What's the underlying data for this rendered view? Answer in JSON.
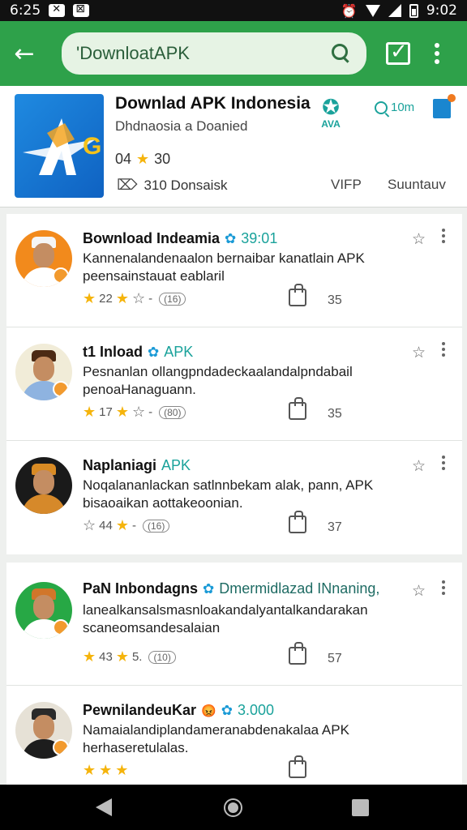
{
  "status_bar": {
    "time_left": "6:25",
    "time_right": "9:02"
  },
  "toolbar": {
    "search_value": "'DownloatAPK"
  },
  "app": {
    "title": "Downlad APK Indonesia",
    "subtitle": "Dhdnaosia a Doanied",
    "rating": "04",
    "reviews": "30",
    "downloads": "310 Donsaisk",
    "vip": "VIFP",
    "subscribe": "Suuntauv",
    "badge": "AVA",
    "quick_search": "10m"
  },
  "comments": [
    {
      "name": "Bownload Indeamia",
      "tag": "39:01",
      "message": "Kannenalandenaalon bernaibar kanatlain APK peensainstauat eablaril",
      "rating_a": "22",
      "rating_b": "(16)",
      "likes": "35",
      "colors": {
        "bg": "#f28a1c",
        "hat": "#f5f5f5",
        "body": "#ffffff"
      }
    },
    {
      "name": "t1 Inload",
      "tag": "APK",
      "message": "Pesnanlan ollangpndadeckaalandalpndabail penoaHanaguann.",
      "rating_a": "17",
      "rating_b": "(80)",
      "likes": "35",
      "colors": {
        "bg": "#f1ecd8",
        "hat": "#4b2a14",
        "body": "#8eb3e0"
      }
    },
    {
      "name": "Naplaniagi",
      "tag": "APK",
      "message": "Noqalananlackan satlnnbekam alak, pann, APK bisaoaikan aottakeoonian.",
      "rating_a": "44",
      "rating_b": "(16)",
      "likes": "37",
      "colors": {
        "bg": "#1a1a1a",
        "hat": "#d98b24",
        "body": "#d6892a"
      }
    },
    {
      "name": "PaN Inbondagns",
      "tag": "Dmermidlazad INnaning,",
      "message": "lanealkansalsmasnloakandalyantalkandarakan scaneomsandesalaian",
      "rating_a": "43",
      "rating_b": "(10)",
      "likes": "57",
      "colors": {
        "bg": "#27a845",
        "hat": "#d1762a",
        "body": "#ffffff"
      }
    },
    {
      "name": "PewnilandeuKar",
      "tag": "3.000",
      "message": "Namaialandiplandameranabdenakalaa APK herhaseretulalas.",
      "rating_a": "",
      "rating_b": "",
      "likes": "",
      "colors": {
        "bg": "#e6e1d6",
        "hat": "#2a2a2a",
        "body": "#1d1d1d"
      }
    }
  ]
}
